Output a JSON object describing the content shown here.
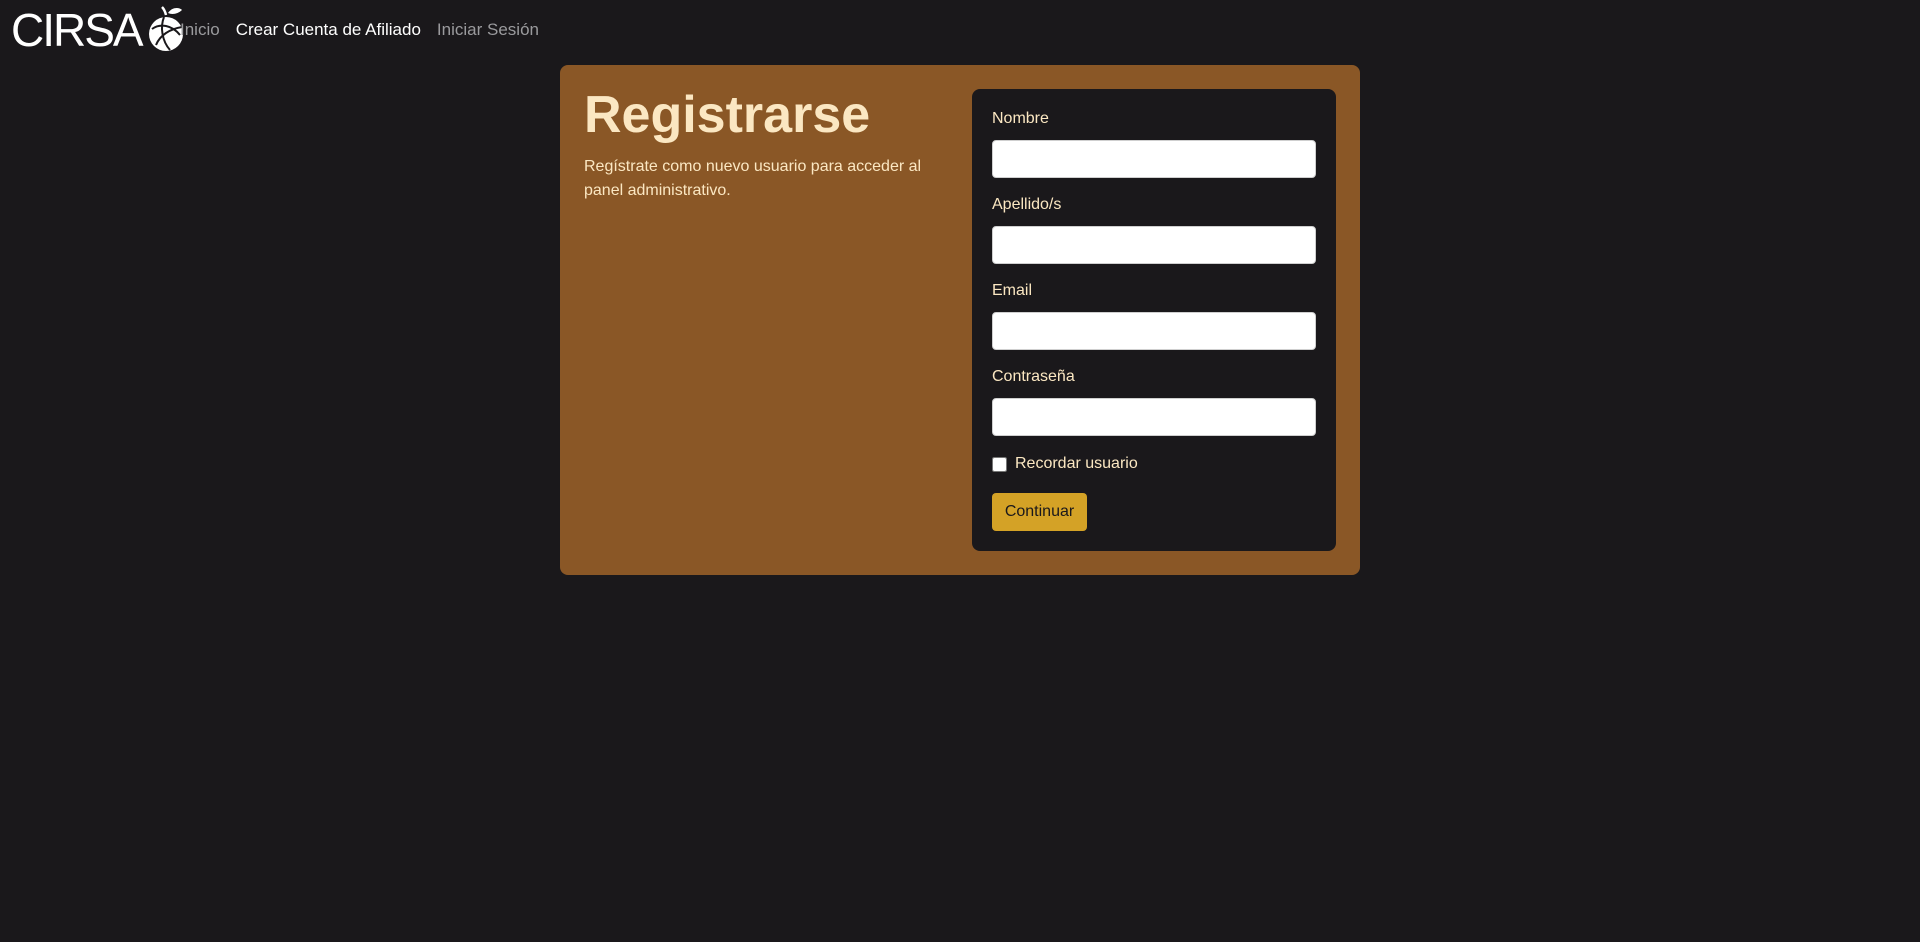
{
  "nav": {
    "logo_text": "CIRSA",
    "links": [
      {
        "label": "Inicio"
      },
      {
        "label": "Crear Cuenta de Afiliado"
      },
      {
        "label": "Iniciar Sesión"
      }
    ]
  },
  "card": {
    "title": "Registrarse",
    "subtitle": "Regístrate como nuevo usuario para acceder al panel administrativo."
  },
  "form": {
    "fields": [
      {
        "label": "Nombre",
        "value": "",
        "placeholder": ""
      },
      {
        "label": "Apellido/s",
        "value": "",
        "placeholder": ""
      },
      {
        "label": "Email",
        "value": "",
        "placeholder": ""
      },
      {
        "label": "Contraseña",
        "value": "",
        "placeholder": ""
      }
    ],
    "remember_label": "Recordar usuario",
    "remember_checked": false,
    "submit_label": "Continuar"
  },
  "colors": {
    "background": "#1a181b",
    "card": "#8a5726",
    "accent_text": "#fbe7c2",
    "button": "#d4a226"
  }
}
